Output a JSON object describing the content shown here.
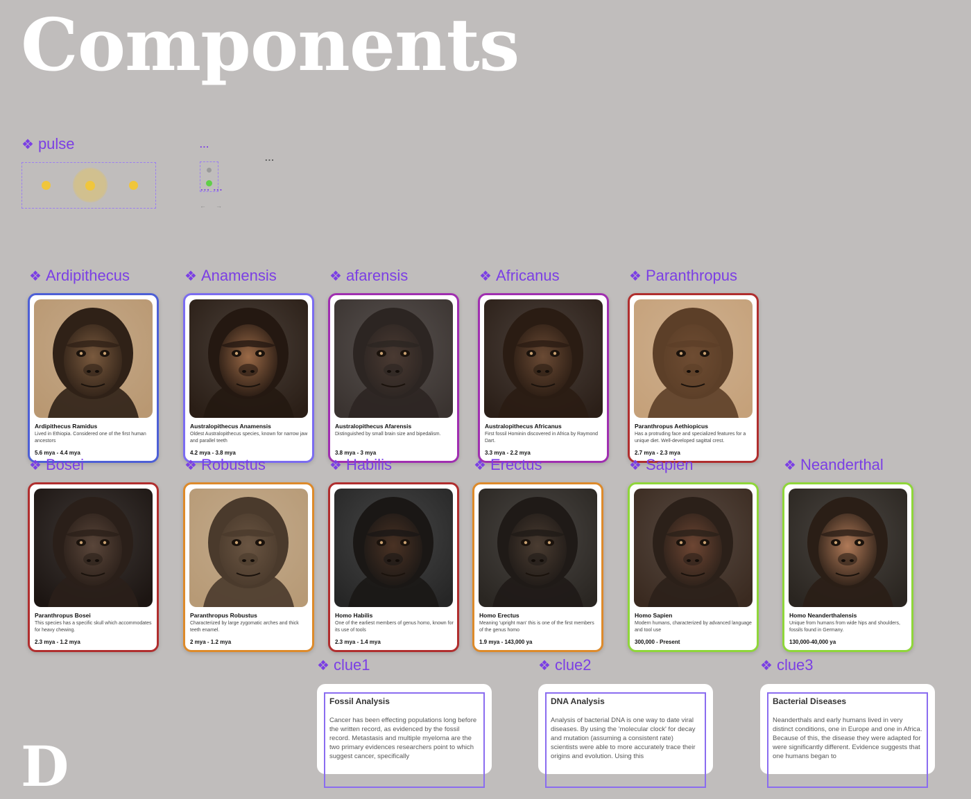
{
  "page": {
    "title": "Components",
    "next_title": "D"
  },
  "pulse": {
    "label": "pulse",
    "mini_label": "...",
    "mini_label2": "...",
    "mini_bottom": "... ...",
    "arrow_left": "←",
    "arrow_right": "→"
  },
  "colors": {
    "label": "#7b3fe4",
    "pulse_dot": "#f0c63c",
    "mini_dot_active": "#5fcf48",
    "mini_dot_inactive": "#9a9a9a"
  },
  "cards": [
    {
      "label": "Ardipithecus",
      "name": "Ardipithecus Ramidus",
      "desc": "Lived in Ethiopia. Considered one of the first human ancestors",
      "era": "5.6 mya - 4.4 mya",
      "border": "#4d5fd6",
      "bg": "#b99872",
      "fur": "#2f2117",
      "skin": "#7a5a3e"
    },
    {
      "label": "Anamensis",
      "name": "Australopithecus Anamensis",
      "desc": "Oldest Australopithecus species, known for narrow jaw and parallel teeth",
      "era": "4.2 mya - 3.8 mya",
      "border": "#7b6cf0",
      "bg": "#2a1e16",
      "fur": "#241811",
      "skin": "#9b6a47"
    },
    {
      "label": "afarensis",
      "name": "Australopithecus Afarensis",
      "desc": "Distinguished by small brain size and bipedalism.",
      "era": "3.8 mya - 3 mya",
      "border": "#a02fb0",
      "bg": "#3a3330",
      "fur": "#2c2522",
      "skin": "#4a3a32"
    },
    {
      "label": "Africanus",
      "name": "Australopithecus Africanus",
      "desc": "First fossil Hominin discovered in Africa by Raymond Dart.",
      "era": "3.3 mya - 2.2 mya",
      "border": "#a02fb0",
      "bg": "#2b1f18",
      "fur": "#2a1c13",
      "skin": "#6a4a34"
    },
    {
      "label": "Paranthropus",
      "name": "Paranthropus Aethiopicus",
      "desc": "Has a protruding face and specialized features for a unique diet. Well-developed sagittal crest.",
      "era": "2.7 mya - 2.3 mya",
      "border": "#b02e2e",
      "bg": "#c5a17a",
      "fur": "#5c3f28",
      "skin": "#6e4c32"
    },
    {
      "label": "Bosei",
      "name": "Paranthropus Bosei",
      "desc": "This species has a specific skull which accommodates for heavy chewing.",
      "era": "2.3 mya - 1.2 mya",
      "border": "#b02e2e",
      "bg": "#1c1512",
      "fur": "#2a1f19",
      "skin": "#5a463a"
    },
    {
      "label": "Robustus",
      "name": "Paranthropus Robustus",
      "desc": "Characterized by large zygomatic arches and thick teeth enamel.",
      "era": "2 mya - 1.2 mya",
      "border": "#dd8a2a",
      "bg": "#b79a76",
      "fur": "#4a3a2c",
      "skin": "#6a5542"
    },
    {
      "label": "Habilis",
      "name": "Homo Habilis",
      "desc": "One of the earliest members of genus homo, known for its use of tools",
      "era": "2.3 mya - 1.4 mya",
      "border": "#b02e2e",
      "bg": "#262626",
      "fur": "#1a1715",
      "skin": "#4a3224"
    },
    {
      "label": "Erectus",
      "name": "Homo Erectus",
      "desc": "Meaning 'upright man' this is one of the first members of the genus homo",
      "era": "1.9 mya - 143,000 ya",
      "border": "#dd8a2a",
      "bg": "#2a2622",
      "fur": "#1f1a17",
      "skin": "#4a3c31"
    },
    {
      "label": "Sapien",
      "name": "Homo Sapien",
      "desc": "Modern humans, characterized by advanced language and tool use",
      "era": "300,000 - Present",
      "border": "#8fd63a",
      "bg": "#3a2a20",
      "fur": "#2b2019",
      "skin": "#6e4633"
    },
    {
      "label": "Neanderthal",
      "name": "Homo Neanderthalensis",
      "desc": "Unique from humans from wide hips and shoulders, fossils found in Germany.",
      "era": "130,000-40,000 ya",
      "border": "#8fd63a",
      "bg": "#2a2520",
      "fur": "#2a1e16",
      "skin": "#b07a58"
    }
  ],
  "clues": [
    {
      "label": "clue1",
      "title": "Fossil Analysis",
      "body": "Cancer has been effecting populations long before the written record, as evidenced by the fossil record. Metastasis and multiple myeloma are the two primary evidences researchers point to which suggest cancer, specifically"
    },
    {
      "label": "clue2",
      "title": "DNA Analysis",
      "body": "Analysis of bacterial DNA is one way to date viral diseases. By using the 'molecular clock' for decay and mutation (assuming a consistent rate) scientists were able to more accurately trace their origins and evolution. Using this"
    },
    {
      "label": "clue3",
      "title": "Bacterial Diseases",
      "body": "Neanderthals and early humans lived in very distinct conditions, one in Europe and one in Africa. Because of this, the disease they were adapted for were significantly different. Evidence suggests that one humans began to"
    }
  ]
}
